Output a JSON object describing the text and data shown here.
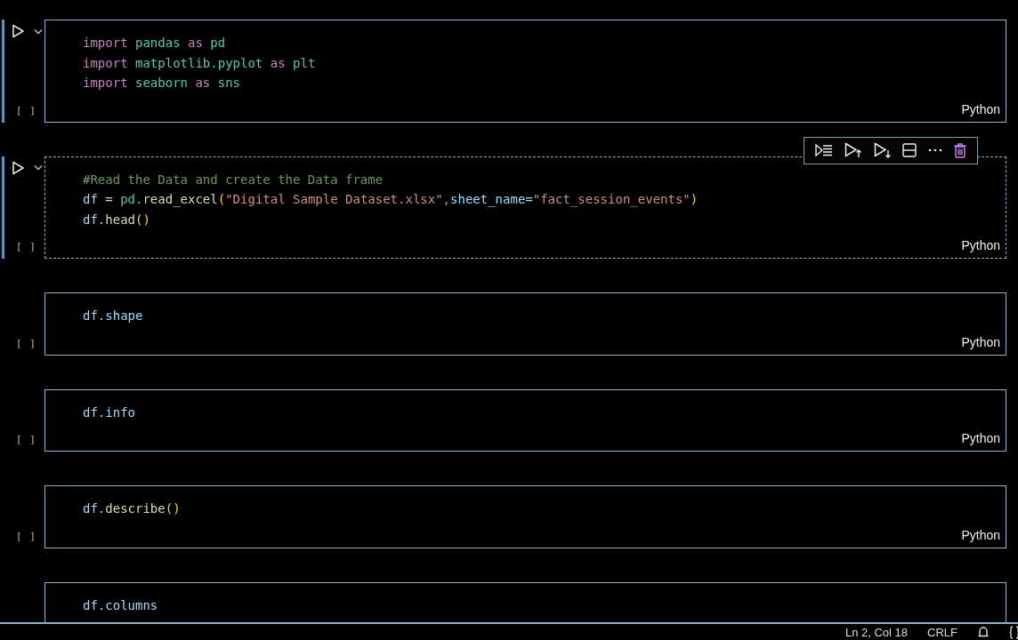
{
  "cells": [
    {
      "active": true,
      "selected": false,
      "exec_count": "[ ]",
      "language": "Python",
      "lines": [
        [
          {
            "kind": "keyword",
            "text": "import"
          },
          {
            "kind": "module",
            "text": " pandas"
          },
          {
            "kind": "keyword",
            "text": " as"
          },
          {
            "kind": "module",
            "text": " pd"
          }
        ],
        [
          {
            "kind": "keyword",
            "text": "import"
          },
          {
            "kind": "module",
            "text": " matplotlib.pyplot"
          },
          {
            "kind": "keyword",
            "text": " as"
          },
          {
            "kind": "module",
            "text": " plt"
          }
        ],
        [
          {
            "kind": "keyword",
            "text": "import"
          },
          {
            "kind": "module",
            "text": " seaborn"
          },
          {
            "kind": "keyword",
            "text": " as"
          },
          {
            "kind": "module",
            "text": " sns"
          }
        ]
      ]
    },
    {
      "active": true,
      "selected": true,
      "exec_count": "[ ]",
      "language": "Python",
      "lines": [
        [
          {
            "kind": "comment",
            "text": "#Read the Data and create the Data frame"
          }
        ],
        [
          {
            "kind": "variable",
            "text": "df"
          },
          {
            "kind": "plain",
            "text": " ="
          },
          {
            "kind": "module",
            "text": " pd."
          },
          {
            "kind": "function",
            "text": "read_excel"
          },
          {
            "kind": "paren",
            "text": "("
          },
          {
            "kind": "string",
            "text": "\"Digital Sample Dataset.xlsx\","
          },
          {
            "kind": "variable",
            "text": "sheet_name="
          },
          {
            "kind": "string",
            "text": "\"fact_session_events\""
          },
          {
            "kind": "paren",
            "text": ")"
          }
        ],
        [
          {
            "kind": "variable",
            "text": "df."
          },
          {
            "kind": "function",
            "text": "head"
          },
          {
            "kind": "paren",
            "text": "()"
          }
        ]
      ]
    },
    {
      "active": false,
      "selected": false,
      "exec_count": "[ ]",
      "language": "Python",
      "lines": [
        [
          {
            "kind": "variable",
            "text": "df.shape"
          }
        ]
      ]
    },
    {
      "active": false,
      "selected": false,
      "exec_count": "[ ]",
      "language": "Python",
      "lines": [
        [
          {
            "kind": "variable",
            "text": "df.info"
          }
        ]
      ]
    },
    {
      "active": false,
      "selected": false,
      "exec_count": "[ ]",
      "language": "Python",
      "lines": [
        [
          {
            "kind": "variable",
            "text": "df."
          },
          {
            "kind": "function",
            "text": "describe"
          },
          {
            "kind": "paren",
            "text": "()"
          }
        ]
      ]
    },
    {
      "active": false,
      "selected": false,
      "lines": [
        [
          {
            "kind": "variable",
            "text": "df.columns"
          }
        ]
      ]
    }
  ],
  "status_bar": {
    "position": "Ln 2, Col 18",
    "line_ending": "CRLF"
  }
}
